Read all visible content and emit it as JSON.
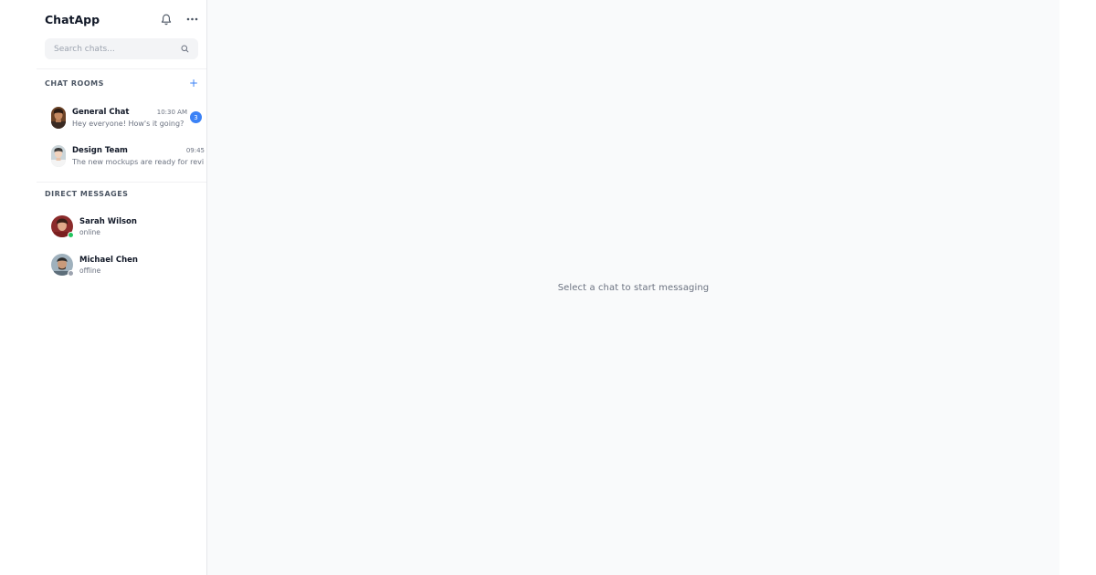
{
  "app": {
    "title": "ChatApp"
  },
  "header": {
    "notifications_icon": "bell-icon",
    "more_icon": "more-horizontal-icon"
  },
  "search": {
    "placeholder": "Search chats...",
    "value": "",
    "icon": "search-icon"
  },
  "sections": {
    "chat_rooms": {
      "title": "CHAT ROOMS",
      "add_label": "+"
    },
    "direct_messages": {
      "title": "DIRECT MESSAGES"
    }
  },
  "rooms": [
    {
      "name": "General Chat",
      "time": "10:30 AM",
      "last_message": "Hey everyone! How's it going?",
      "unread": "3"
    },
    {
      "name": "Design Team",
      "time": "09:45",
      "last_message": "The new mockups are ready for revi"
    }
  ],
  "direct_messages": [
    {
      "name": "Sarah Wilson",
      "status": "online",
      "status_color": "#22c55e"
    },
    {
      "name": "Michael Chen",
      "status": "offline",
      "status_color": "#9ca3af"
    }
  ],
  "main": {
    "empty_state": "Select a chat to start messaging"
  },
  "colors": {
    "accent": "#3b82f6",
    "sidebar_bg": "#ffffff",
    "main_bg": "#f9fafb"
  }
}
